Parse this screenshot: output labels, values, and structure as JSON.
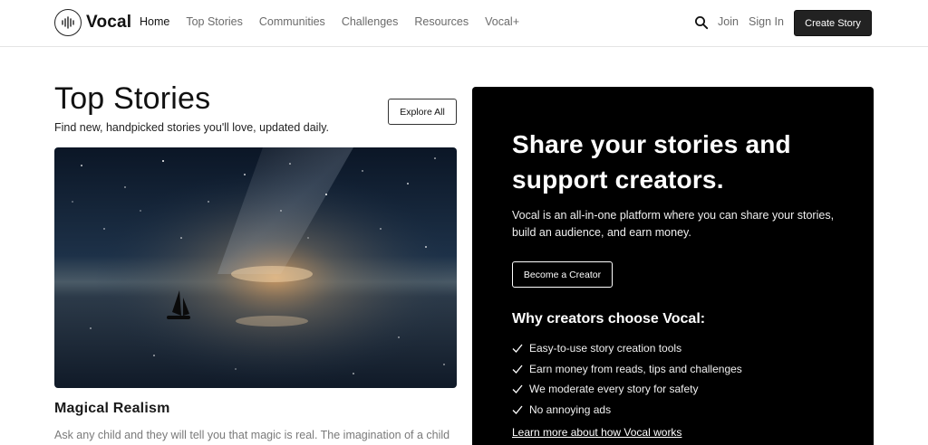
{
  "header": {
    "logo_text": "Vocal",
    "nav": [
      "Home",
      "Top Stories",
      "Communities",
      "Challenges",
      "Resources",
      "Vocal+"
    ],
    "active_nav": "Home",
    "join_label": "Join",
    "signin_label": "Sign In",
    "create_label": "Create Story"
  },
  "top_stories": {
    "title": "Top Stories",
    "subtitle": "Find new, handpicked stories you'll love, updated daily.",
    "explore_label": "Explore All",
    "featured": {
      "title": "Magical Realism",
      "excerpt": "Ask any child and they will tell you that magic is real. The imagination of a child"
    }
  },
  "promo": {
    "heading": "Share your stories and support creators.",
    "description": "Vocal is an all-in-one platform where you can share your stories, build an audience, and earn money.",
    "cta_label": "Become a Creator",
    "why_heading": "Why creators choose Vocal:",
    "reasons": [
      "Easy-to-use story creation tools",
      "Earn money from reads, tips and challenges",
      "We moderate every story for safety",
      "No annoying ads"
    ],
    "learn_more": "Learn more about how Vocal works"
  },
  "icons": {
    "search": "search-icon",
    "logo": "soundwave-logo-icon",
    "check": "check-icon"
  },
  "colors": {
    "primary_button": "#222222",
    "panel_background": "#000000",
    "nav_text": "#6b6b6b"
  }
}
